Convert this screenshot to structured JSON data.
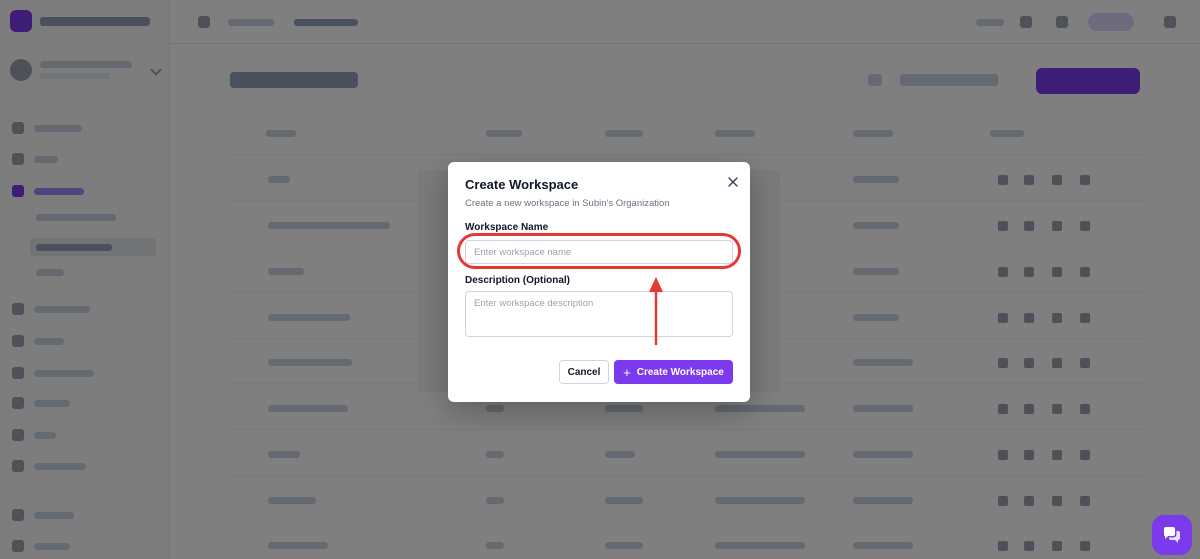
{
  "dialog": {
    "title": "Create Workspace",
    "subtitle": "Create a new workspace in Subin's Organization",
    "name_label": "Workspace Name",
    "name_placeholder": "Enter workspace name",
    "name_value": "",
    "description_label": "Description (Optional)",
    "description_placeholder": "Enter workspace description",
    "description_value": "",
    "cancel_label": "Cancel",
    "create_label": "Create Workspace",
    "close_icon": "close-icon",
    "create_icon": "plus-icon"
  },
  "annotation": {
    "color": "#e53935",
    "target": "workspace-name-input"
  },
  "colors": {
    "brand": "#7c3aed",
    "overlay": "rgba(0,0,0,0.5)"
  },
  "chat_fab": {
    "icon": "chat-bubbles-icon"
  }
}
